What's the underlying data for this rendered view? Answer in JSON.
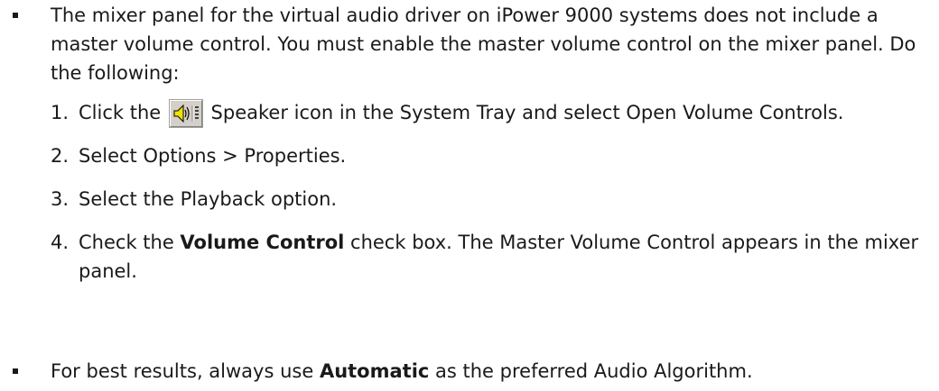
{
  "bullets": [
    {
      "text": "The mixer panel for the virtual audio driver on iPower 9000 systems does not include a master volume control. You must enable the master volume control on the mixer panel. Do the following:"
    },
    {
      "text_before": "For best results, always use ",
      "bold": "Automatic",
      "text_after": " as the preferred Audio Algorithm."
    }
  ],
  "steps": [
    {
      "number": "1.",
      "text_before_icon": "Click the ",
      "icon": "speaker-icon",
      "text_after_icon": " Speaker icon in the System Tray and select Open Volume Controls."
    },
    {
      "number": "2.",
      "text": "Select Options > Properties."
    },
    {
      "number": "3.",
      "text": "Select the Playback option."
    },
    {
      "number": "4.",
      "text_before": "Check the ",
      "bold": "Volume Control",
      "text_after": " check box. The Master Volume Control appears in the mixer panel."
    }
  ]
}
